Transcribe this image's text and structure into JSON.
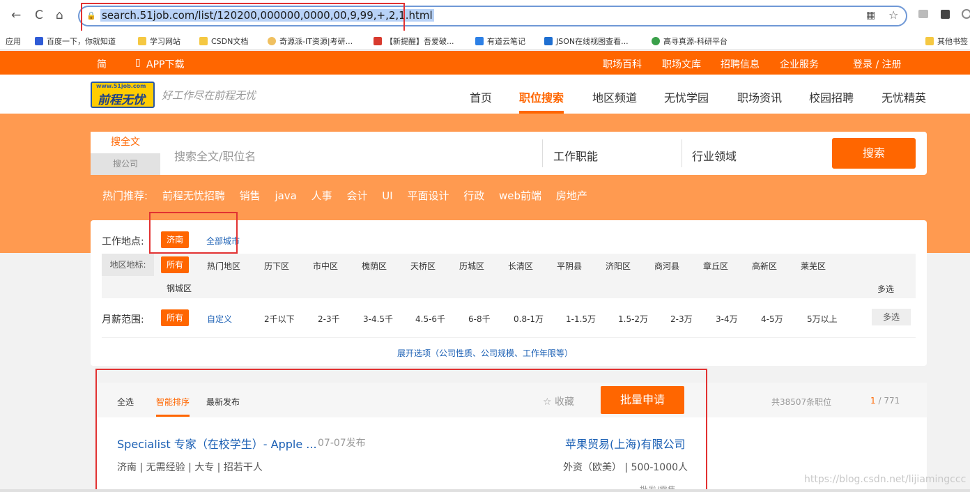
{
  "browser": {
    "back": "←",
    "reload": "C",
    "home": "⌂",
    "url": "search.51job.com/list/120200,000000,0000,00,9,99,+,2,1.html",
    "bookmarks": [
      {
        "label": "应用"
      },
      {
        "label": "百度一下，你就知道"
      },
      {
        "label": "学习网站"
      },
      {
        "label": "CSDN文档"
      },
      {
        "label": "奇源派-IT资源|考研..."
      },
      {
        "label": "【新提醒】吾爱破..."
      },
      {
        "label": "有道云笔记"
      },
      {
        "label": "JSON在线视图查看..."
      },
      {
        "label": "高寻真源-科研平台"
      },
      {
        "label": "其他书签"
      }
    ]
  },
  "topbar": {
    "simplified": "简",
    "app": "APP下载",
    "links": [
      "职场百科",
      "职场文库",
      "招聘信息",
      "企业服务"
    ],
    "login": "登录 / 注册"
  },
  "header": {
    "logo_top": "www.51job.com",
    "logo_main": "前程无忧",
    "slogan": "好工作尽在前程无忧",
    "nav": [
      "首页",
      "职位搜索",
      "地区频道",
      "无忧学园",
      "职场资讯",
      "校园招聘",
      "无忧精英"
    ]
  },
  "search": {
    "tab_all": "搜全文",
    "tab_company": "搜公司",
    "placeholder": "搜索全文/职位名",
    "function": "工作职能",
    "industry": "行业领域",
    "button": "搜索",
    "hot_label": "热门推荐:",
    "hot": [
      "前程无忧招聘",
      "销售",
      "java",
      "人事",
      "会计",
      "UI",
      "平面设计",
      "行政",
      "web前端",
      "房地产"
    ]
  },
  "filter": {
    "location_label": "工作地点:",
    "location_selected": "济南",
    "all_cities": "全部城市",
    "area_label": "地区地标:",
    "area_all": "所有",
    "areas": [
      "热门地区",
      "历下区",
      "市中区",
      "槐荫区",
      "天桥区",
      "历城区",
      "长清区",
      "平阴县",
      "济阳区",
      "商河县",
      "章丘区",
      "高新区",
      "莱芜区"
    ],
    "area_extra": "钢城区",
    "multi": "多选",
    "salary_label": "月薪范围:",
    "salary_all": "所有",
    "salary_custom": "自定义",
    "salaries": [
      "2千以下",
      "2-3千",
      "3-4.5千",
      "4.5-6千",
      "6-8千",
      "0.8-1万",
      "1-1.5万",
      "1.5-2万",
      "2-3万",
      "3-4万",
      "4-5万",
      "5万以上"
    ],
    "expand": "展开选项（公司性质、公司规模、工作年限等）"
  },
  "results": {
    "select_all": "全选",
    "smart_sort": "智能排序",
    "latest": "最新发布",
    "favorite": "收藏",
    "batch_apply": "批量申请",
    "total": "共38507条职位",
    "page_current": "1",
    "page_total": "/ 771",
    "job": {
      "title": "Specialist 专家（在校学生）- Apple ...",
      "date": "07-07发布",
      "company": "苹果贸易(上海)有限公司",
      "meta": "济南 | 无需经验 | 大专 | 招若干人",
      "company_meta": "外资（欧美） | 500-1000人",
      "industry": "批发/零售"
    }
  },
  "watermark": "https://blog.csdn.net/lijiamingccc",
  "colors": {
    "brand": "#ff6600",
    "band": "#ff9a50",
    "link": "#1a5fb4",
    "highlight_box": "#e23232"
  }
}
